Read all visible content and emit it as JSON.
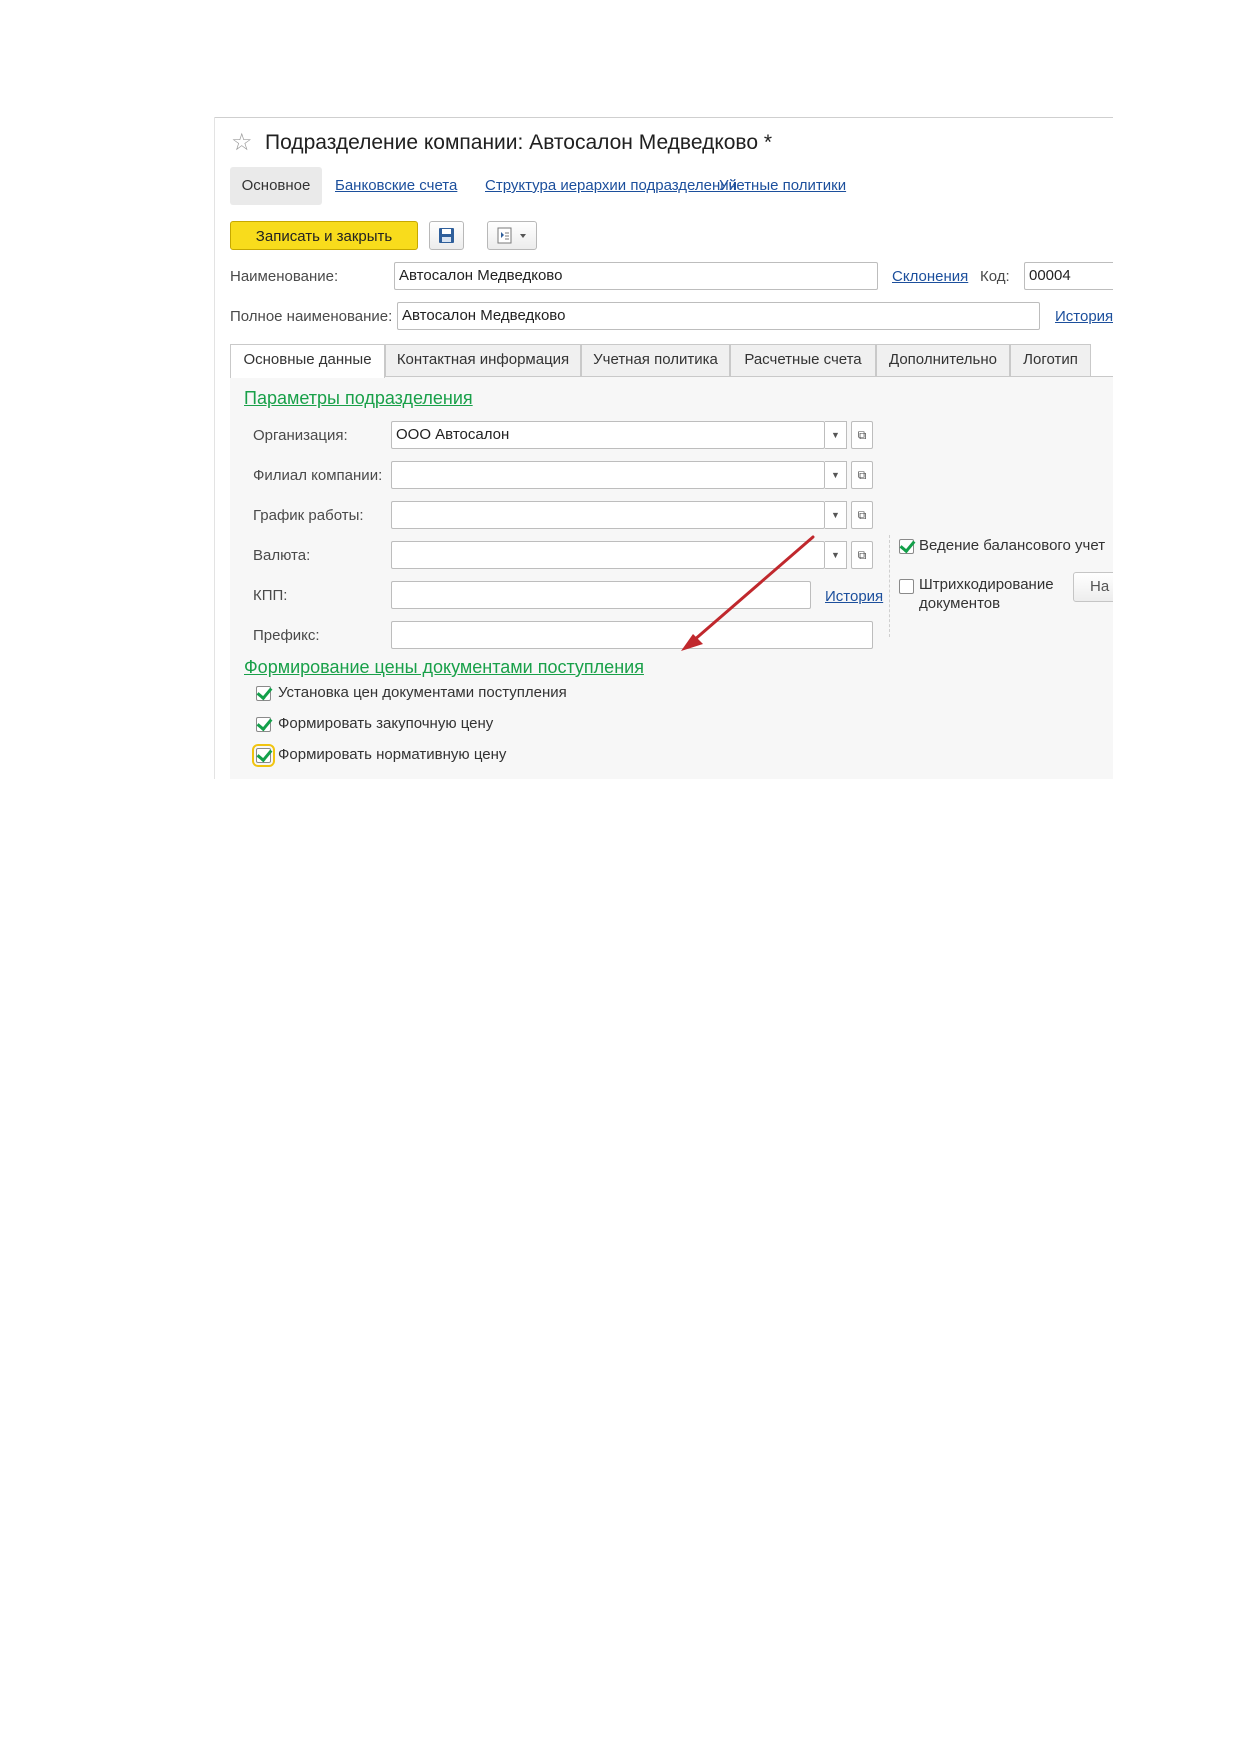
{
  "window": {
    "title": "Подразделение компании: Автосалон Медведково *",
    "star_icon": "star-icon"
  },
  "nav": {
    "active": "Основное",
    "links": [
      "Банковские счета",
      "Структура иерархии подразделений",
      "Учетные политики"
    ]
  },
  "toolbar": {
    "save_close": "Записать и закрыть",
    "save_icon": "floppy-disk-icon",
    "more_icon": "document-menu-icon",
    "primary_color": "#f8dc1c"
  },
  "header_fields": {
    "name_label": "Наименование:",
    "name_value": "Автосалон Медведково",
    "declensions_link": "Склонения",
    "code_label": "Код:",
    "code_value": "00004",
    "full_name_label": "Полное наименование:",
    "full_name_value": "Автосалон Медведково",
    "history_link": "История"
  },
  "tabs": [
    "Основные данные",
    "Контактная информация",
    "Учетная политика",
    "Расчетные счета",
    "Дополнительно",
    "Логотип"
  ],
  "params": {
    "title": "Параметры подразделения",
    "org_label": "Организация:",
    "org_value": "ООО Автосалон",
    "branch_label": "Филиал компании:",
    "schedule_label": "График работы:",
    "currency_label": "Валюта:",
    "kpp_label": "КПП:",
    "kpp_history": "История",
    "prefix_label": "Префикс:",
    "balance_check": {
      "label": "Ведение балансового учет",
      "checked": true
    },
    "barcode_check": {
      "label_line1": "Штрихкодирование",
      "label_line2": "документов",
      "checked": false
    },
    "side_button": "На"
  },
  "pricing": {
    "title": "Формирование цены документами поступления",
    "items": [
      {
        "label": "Установка цен документами поступления",
        "checked": true
      },
      {
        "label": "Формировать закупочную цену",
        "checked": true
      },
      {
        "label": "Формировать нормативную цену",
        "checked": true
      }
    ]
  },
  "colors": {
    "link": "#1c4f9c",
    "group_title": "#19a049",
    "check": "#13a04a",
    "arrow": "#c0282d"
  }
}
